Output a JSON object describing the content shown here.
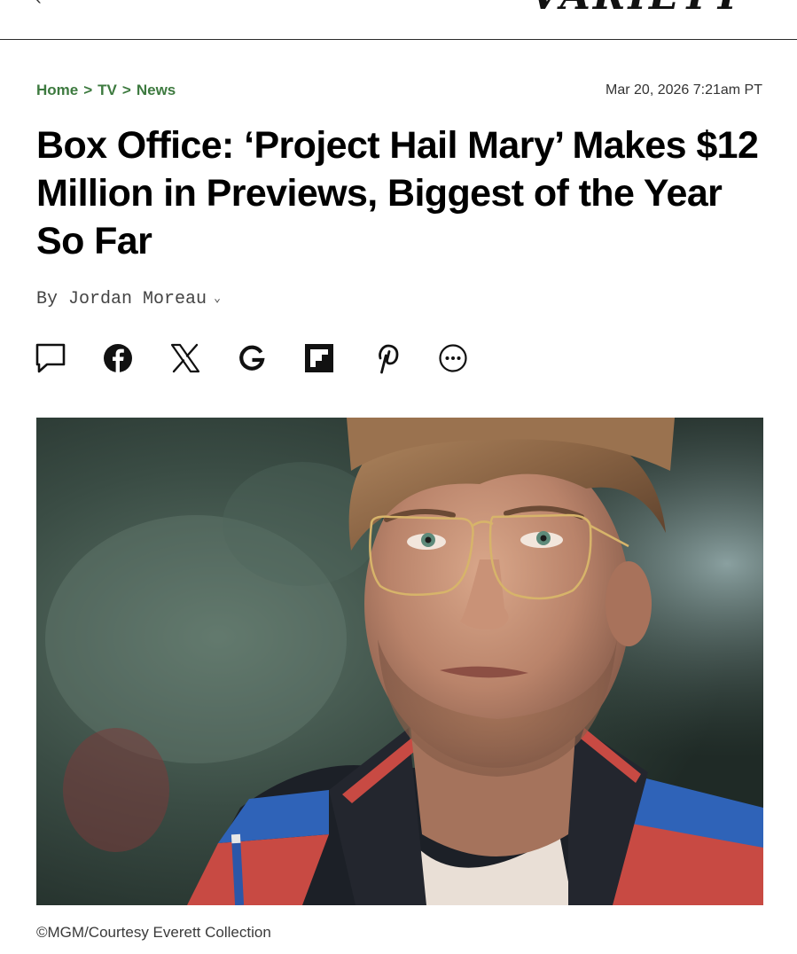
{
  "header": {
    "logo_text": "VARIETY",
    "back_glyph": "‹"
  },
  "breadcrumb": {
    "items": [
      "Home",
      "TV",
      "News"
    ],
    "separator": ">"
  },
  "article": {
    "timestamp": "Mar 20, 2026 7:21am PT",
    "headline": "Box Office: ‘Project Hail Mary’ Makes $12 Million in Previews, Biggest of the Year So Far",
    "byline_prefix": "By",
    "author": "Jordan Moreau",
    "caption": "©MGM/Courtesy Everett Collection"
  },
  "share": {
    "icons": [
      "comment-icon",
      "facebook-icon",
      "x-icon",
      "google-icon",
      "flipboard-icon",
      "pinterest-icon",
      "more-icon"
    ]
  },
  "colors": {
    "breadcrumb_green": "#3d7a3f",
    "text": "#000000",
    "divider": "#2b2b2b"
  }
}
